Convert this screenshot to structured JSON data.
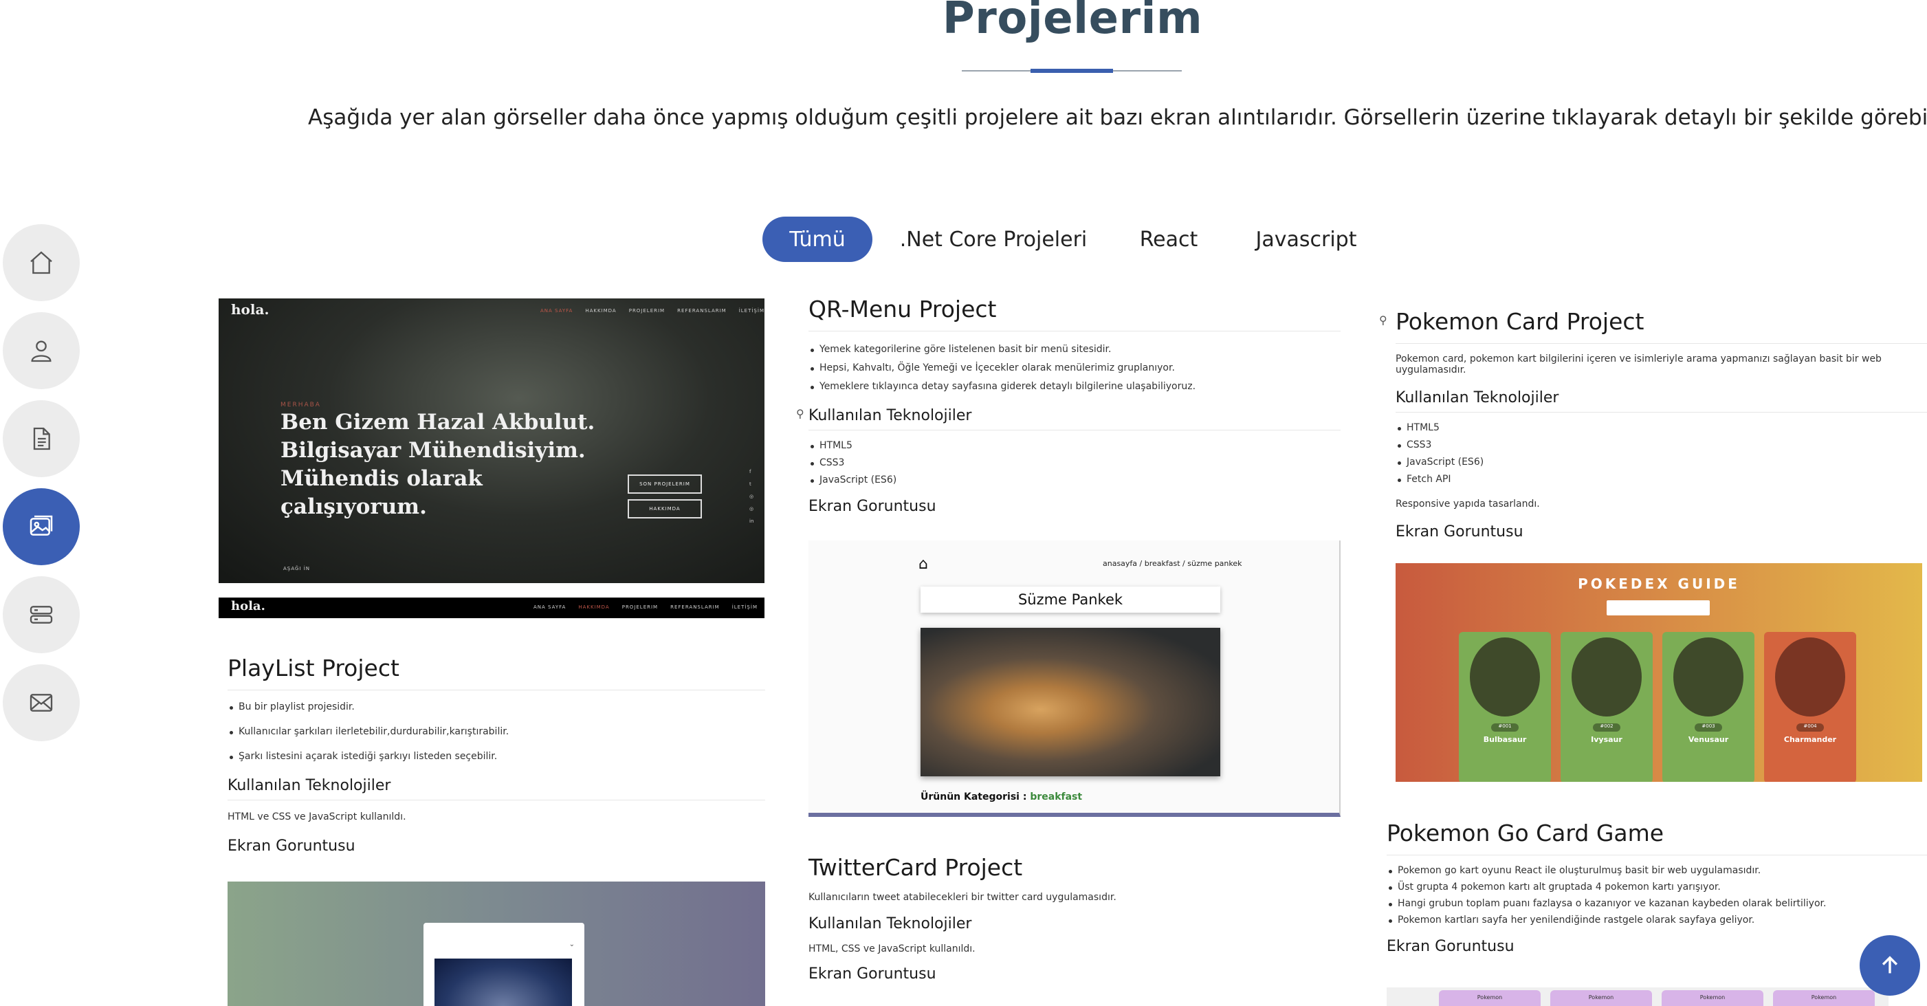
{
  "header": {
    "title": "Projelerim",
    "intro": "Aşağıda yer alan görseller daha önce yapmış olduğum çeşitli projelere ait bazı ekran alıntılarıdır. Görsellerin üzerine tıklayarak detaylı bir şekilde görebilirsiniz."
  },
  "sidenav": {
    "items": [
      {
        "icon": "home-icon"
      },
      {
        "icon": "user-icon"
      },
      {
        "icon": "document-icon"
      },
      {
        "icon": "gallery-icon",
        "active": true
      },
      {
        "icon": "server-icon"
      },
      {
        "icon": "mail-icon"
      }
    ]
  },
  "filters": {
    "tabs": [
      {
        "label": "Tümü",
        "active": true
      },
      {
        "label": ".Net Core Projeleri"
      },
      {
        "label": "React"
      },
      {
        "label": "Javascript"
      }
    ]
  },
  "hola": {
    "logo": "hola.",
    "nav": [
      "ANA SAYFA",
      "HAKKIMDA",
      "PROJELERIM",
      "REFERANSLARIM",
      "İLETİŞİM"
    ],
    "tag": "MERHABA",
    "headline": [
      "Ben Gizem Hazal Akbulut.",
      "Bilgisayar Mühendisiyim.",
      "Mühendis olarak",
      "çalışıyorum."
    ],
    "btn1": "SON PROJELERIM",
    "btn2": "HAKKIMDA",
    "social": [
      "f",
      "t",
      "◎",
      "◎",
      "in"
    ],
    "down": "AŞAĞI İN",
    "bar_logo": "hola."
  },
  "playlist": {
    "title": "PlayList Project",
    "bullets": [
      "Bu bir playlist projesidir.",
      "Kullanıcılar şarkıları ilerletebilir,durdurabilir,karıştırabilir.",
      "Şarkı listesini açarak istediği şarkıyı listeden seçebilir."
    ],
    "tech_heading": "Kullanılan Teknolojiler",
    "tech_text": "HTML ve CSS ve JavaScript kullanıldı.",
    "screen_heading": "Ekran Goruntusu"
  },
  "qrmenu": {
    "title": "QR-Menu Project",
    "bullets": [
      "Yemek kategorilerine göre listelenen basit bir menü sitesidir.",
      "Hepsi, Kahvaltı, Öğle Yemeği ve İçecekler olarak menülerimiz gruplanıyor.",
      "Yemeklere tıklayınca detay sayfasına giderek detaylı bilgilerine ulaşabiliyoruz."
    ],
    "link_mark": "🔗",
    "tech_heading": "Kullanılan Teknolojiler",
    "tech": [
      "HTML5",
      "CSS3",
      "JavaScript (ES6)"
    ],
    "screen_heading": "Ekran Goruntusu",
    "shot": {
      "breadcrumb": "anasayfa / breakfast / süzme pankek",
      "product": "Süzme Pankek",
      "category_label": "Ürünün Kategorisi :",
      "category_value": "breakfast"
    }
  },
  "twitter": {
    "title": "TwitterCard Project",
    "desc": "Kullanıcıların tweet atabilecekleri bir twitter card uygulamasıdır.",
    "tech_heading": "Kullanılan Teknolojiler",
    "tech_text": "HTML, CSS ve JavaScript kullanıldı.",
    "screen_heading": "Ekran Goruntusu"
  },
  "pokemon": {
    "link_mark": "🔗",
    "title": "Pokemon Card Project",
    "desc": "Pokemon card, pokemon kart bilgilerini içeren ve isimleriyle arama yapmanızı sağlayan basit bir web uygulamasıdır.",
    "tech_heading": "Kullanılan Teknolojiler",
    "tech": [
      "HTML5",
      "CSS3",
      "JavaScript (ES6)",
      "Fetch API"
    ],
    "responsive": "Responsive yapıda tasarlandı.",
    "screen_heading": "Ekran Goruntusu",
    "shot": {
      "title": "POKEDEX GUIDE",
      "cards": [
        {
          "id": "#001",
          "name": "Bulbasaur",
          "color": "#7cad55"
        },
        {
          "id": "#002",
          "name": "Ivysaur",
          "color": "#7cad55"
        },
        {
          "id": "#003",
          "name": "Venusaur",
          "color": "#7cad55"
        },
        {
          "id": "#004",
          "name": "Charmander",
          "color": "#d4643e"
        }
      ]
    }
  },
  "pokego": {
    "title": "Pokemon Go Card Game",
    "bullets": [
      "Pokemon go kart oyunu React ile oluşturulmuş basit bir web uygulamasıdır.",
      "Üst grupta 4 pokemon kartı alt gruptada 4 pokemon kartı yarışıyor.",
      "Hangi grubun toplam puanı fazlaysa o kazanıyor ve kazanan kaybeden olarak belirtiliyor.",
      "Pokemon kartları sayfa her yenilendiğinde rastgele olarak sayfaya geliyor."
    ],
    "screen_heading": "Ekran Goruntusu",
    "tab_label": "Pokemon"
  }
}
